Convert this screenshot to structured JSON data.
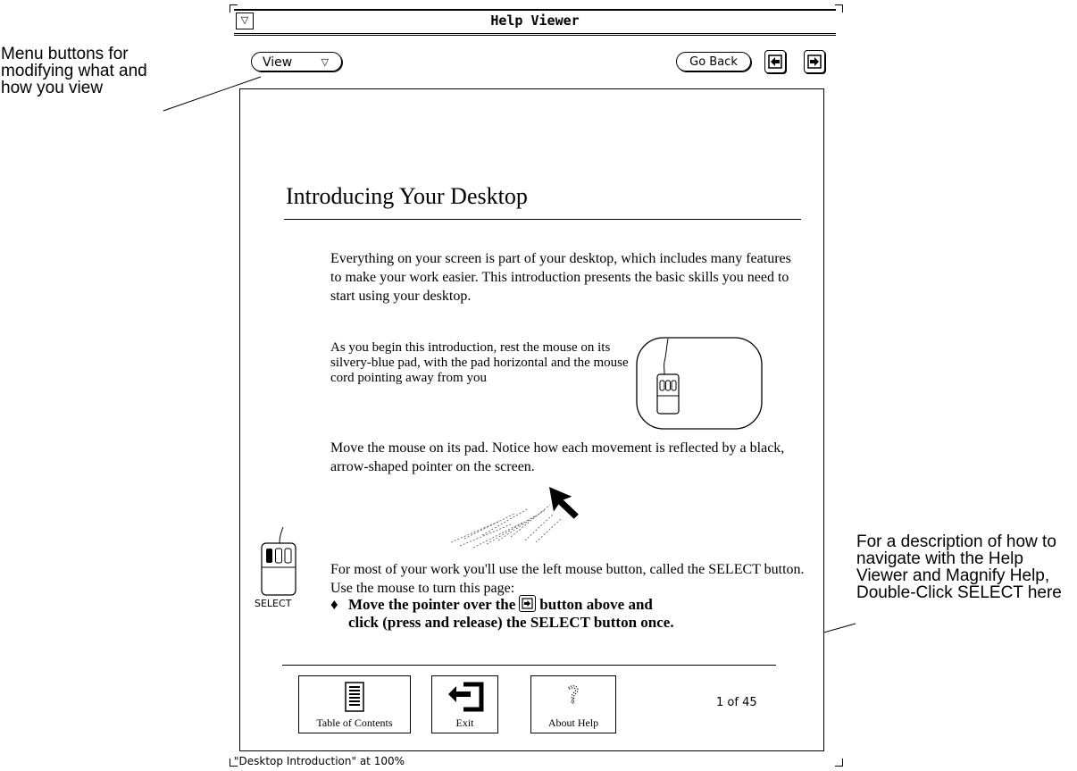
{
  "callouts": {
    "menu_buttons": "Menu buttons for modifying what and how you view",
    "about_help": "For a description of how to navigate with the Help Viewer and Magnify Help, Double-Click SELECT here"
  },
  "window": {
    "title": "Help Viewer",
    "menu_glyph": "▽"
  },
  "toolbar": {
    "view_label": "View",
    "view_chevron": "▽",
    "go_back_label": "Go Back"
  },
  "content": {
    "heading": "Introducing Your  Desktop",
    "para1": "Everything on your screen is part of your desktop, which includes many features to make your work easier. This introduction presents the basic skills you need to start using your desktop.",
    "para2": "As you begin this introduction, rest the mouse on its silvery-blue pad, with the pad horizontal and the mouse cord pointing away from you",
    "para3": "Move the mouse on its pad. Notice how each movement is reflected by a black, arrow-shaped pointer on the screen.",
    "para4": "For most of your work you'll use the left mouse button, called the SELECT button. Use the mouse to turn this page:",
    "instruction_bullet": "♦",
    "instruction_part1": "Move the pointer over the",
    "instruction_part2": "button above and",
    "instruction_line2": "click (press and release) the SELECT button once.",
    "select_label": "SELECT"
  },
  "footer": {
    "toc_label": "Table of Contents",
    "exit_label": "Exit",
    "about_label": "About Help",
    "page_counter": "1 of 45"
  },
  "status": {
    "text": "\"Desktop Introduction\" at 100%"
  }
}
